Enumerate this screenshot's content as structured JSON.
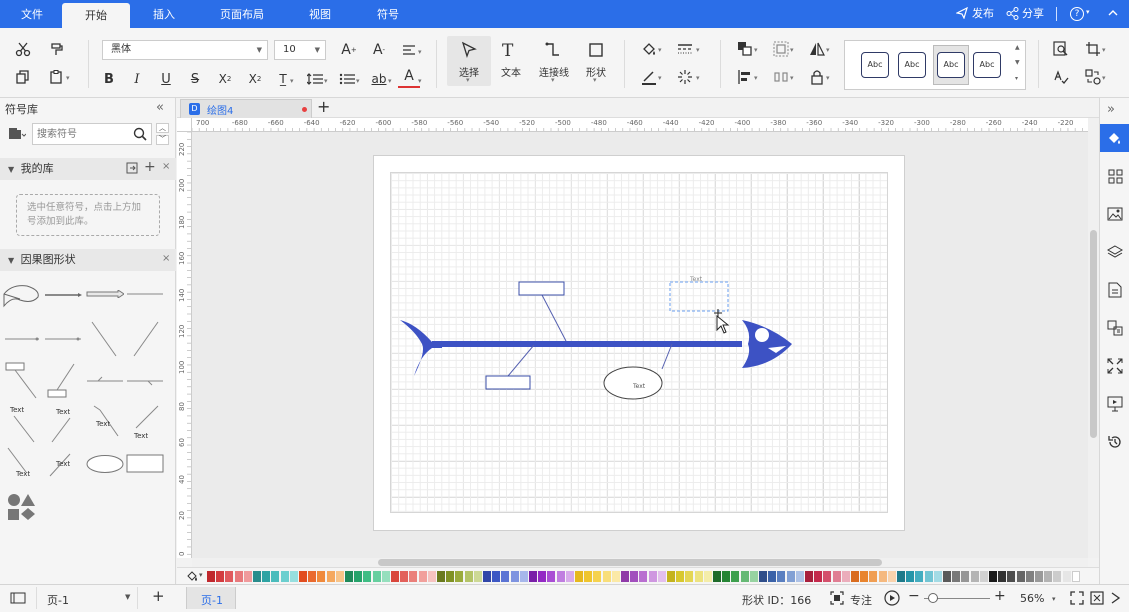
{
  "menubar": {
    "tabs": [
      "文件",
      "开始",
      "插入",
      "页面布局",
      "视图",
      "符号"
    ],
    "active_tab": "开始",
    "publish_label": "发布",
    "share_label": "分享",
    "help_label": "?"
  },
  "toolbar": {
    "font_name": "黑体",
    "font_size": "10",
    "big_tools": [
      "选择",
      "文本",
      "连接线",
      "形状"
    ],
    "style_presets": [
      "Abc",
      "Abc",
      "Abc",
      "Abc"
    ]
  },
  "left_panel": {
    "title": "符号库",
    "search_placeholder": "搜索符号",
    "my_library": {
      "title": "我的库",
      "hint": "选中任意符号，点击上方加号添加到此库。"
    },
    "cause_effect": {
      "title": "因果图形状",
      "shape_texts": [
        "Text",
        "Text",
        "Text",
        "Text",
        "Text",
        "Text"
      ]
    }
  },
  "document": {
    "tab_title": "绘图4",
    "ruler_h": [
      "700",
      "-680",
      "-660",
      "-640",
      "-620",
      "-600",
      "-580",
      "-560",
      "-540",
      "-520",
      "-500",
      "-480",
      "-460",
      "-440",
      "-420",
      "-400",
      "-380",
      "-360",
      "-340",
      "-320",
      "-300",
      "-280",
      "-260",
      "-240",
      "-220",
      "-2"
    ],
    "ruler_v": [
      "220",
      "200",
      "180",
      "160",
      "140",
      "120",
      "100",
      "80",
      "60",
      "40",
      "20",
      "0"
    ],
    "shapes": {
      "text_box_label": "Text",
      "ellipse_label": "Text"
    }
  },
  "statusbar": {
    "page_selector": "页-1",
    "page_tab": "页-1",
    "shape_id": "形状 ID：166",
    "focus_label": "专注",
    "zoom": "56%"
  },
  "colors": {
    "accent": "#2b6ee8",
    "fish": "#3d52c4",
    "palette": [
      "#c0282d",
      "#d33b3f",
      "#e05a5e",
      "#e8797c",
      "#f09a9c",
      "#2a8c8c",
      "#2ea3a3",
      "#4bbcbc",
      "#6ccfcf",
      "#97dfdf",
      "#e24d1f",
      "#ea6a2e",
      "#f08a3c",
      "#f5a85e",
      "#f8c489",
      "#1f8a5a",
      "#26a36b",
      "#3ebd84",
      "#66cf9f",
      "#95dfbd",
      "#d9463c",
      "#e2605a",
      "#ea7f7a",
      "#f1a09c",
      "#f6c3c0",
      "#6a7a1e",
      "#809224",
      "#9aab3c",
      "#b4c467",
      "#cdd995",
      "#3046a8",
      "#3d58c4",
      "#5b74d4",
      "#7f94e0",
      "#a7b7eb",
      "#7a1fa8",
      "#9329c4",
      "#a94ed4",
      "#c07ee0",
      "#d8abeb",
      "#e6b81e",
      "#efc52e",
      "#f5d24e",
      "#f8de7a",
      "#fbe9a6",
      "#8f3aa8",
      "#a24fbd",
      "#b96fd0",
      "#cf97e0",
      "#e3bfed",
      "#c4b31e",
      "#d8c82e",
      "#e4d654",
      "#ede37f",
      "#f4eda9",
      "#1e6b2a",
      "#268535",
      "#3ea04e",
      "#66b975",
      "#97d3a1",
      "#2f4e8a",
      "#3b62a8",
      "#5a7fc0",
      "#82a0d4",
      "#aec2e6",
      "#a81f3c",
      "#c42a4c",
      "#d4506c",
      "#e07e93",
      "#ebadbb",
      "#d96c1f",
      "#e8842e",
      "#f09e53",
      "#f5b97f",
      "#f9d3ad",
      "#1e7a8a",
      "#2695a8",
      "#44adc0",
      "#72c5d4",
      "#a3dbe5",
      "#5a5a5a",
      "#787878",
      "#969696",
      "#b4b4b4",
      "#d2d2d2",
      "#1a1a1a",
      "#333333",
      "#4d4d4d",
      "#666666",
      "#808080",
      "#999999",
      "#b3b3b3",
      "#cccccc",
      "#e6e6e6",
      "#ffffff"
    ]
  }
}
